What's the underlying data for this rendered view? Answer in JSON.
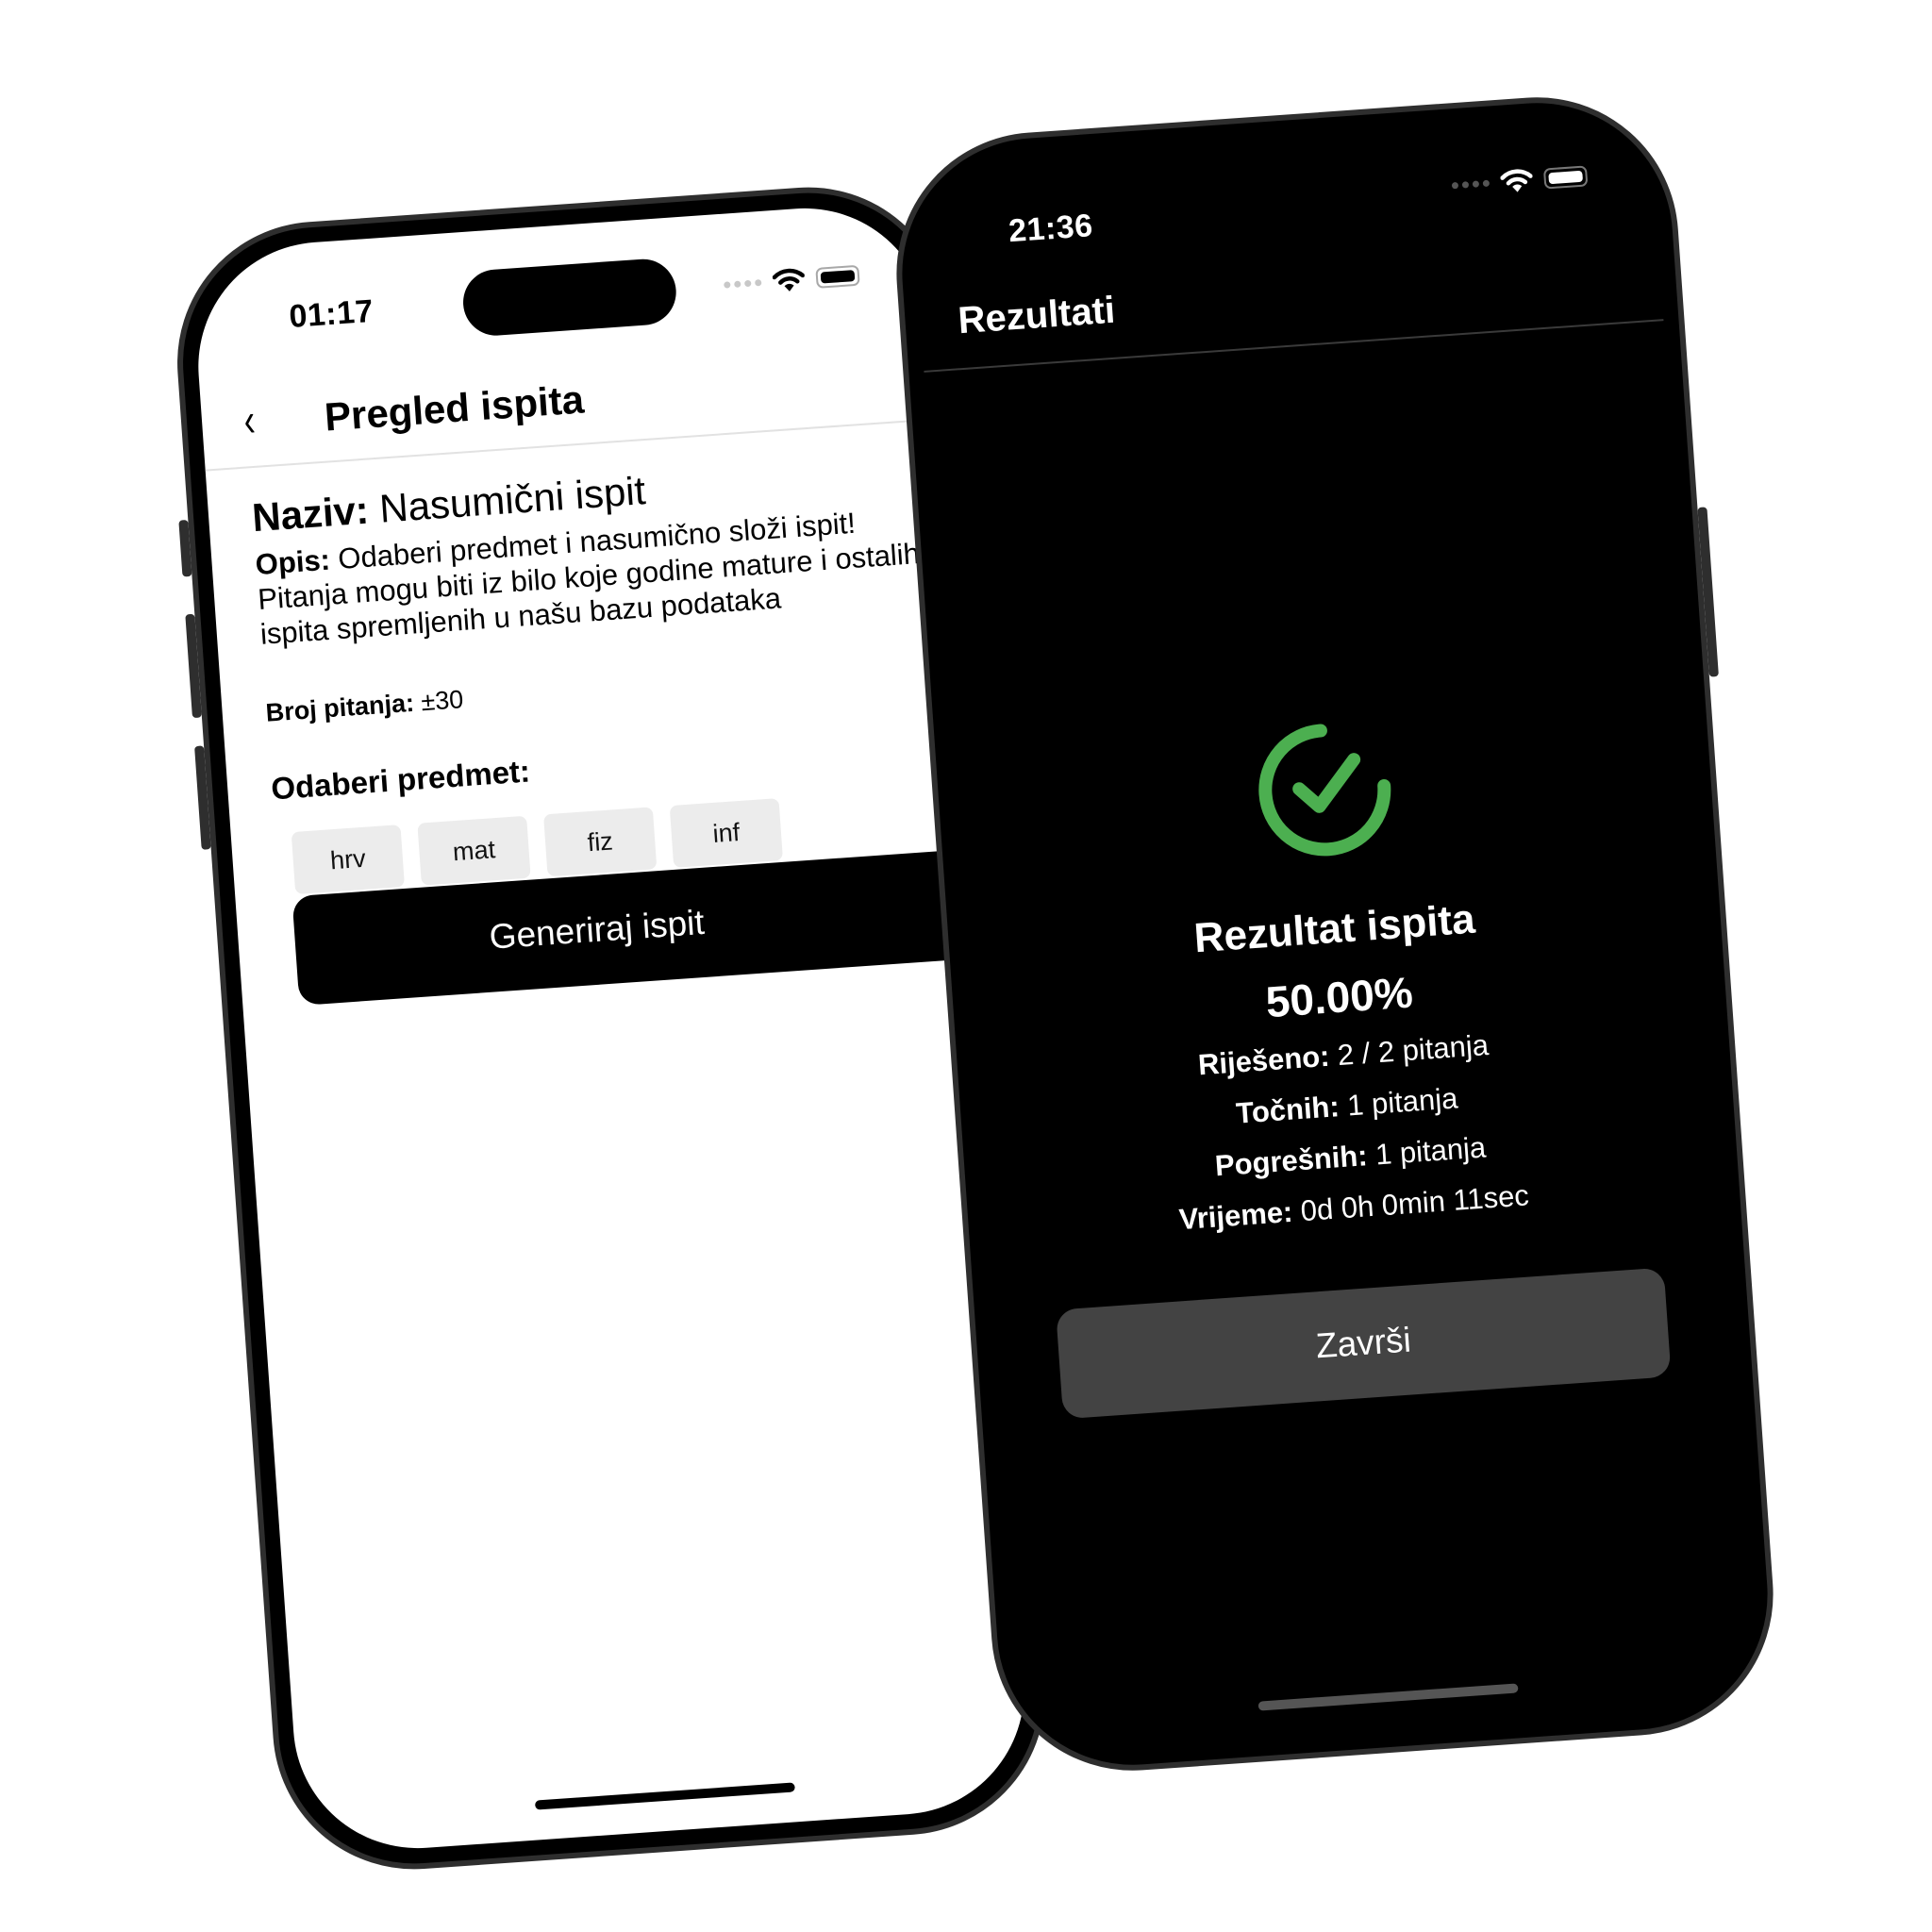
{
  "left_phone": {
    "status_bar": {
      "time": "01:17",
      "icons": [
        "signal-dots-icon",
        "wifi-icon",
        "battery-icon"
      ]
    },
    "nav": {
      "back_icon": "chevron-left-icon",
      "title": "Pregled ispita"
    },
    "exam": {
      "name_label": "Naziv:",
      "name_value": "Nasumični ispit",
      "desc_label": "Opis:",
      "desc_value": "Odaberi predmet i nasumično složi ispit! Pitanja mogu biti iz bilo koje godine mature i ostalih ispita spremljenih u našu bazu podataka",
      "count_label": "Broj pitanja:",
      "count_value": "±30",
      "subject_heading": "Odaberi predmet:",
      "subjects": [
        "hrv",
        "mat",
        "fiz",
        "inf"
      ]
    },
    "generate_button": "Generiraj ispit"
  },
  "right_phone": {
    "status_bar": {
      "time": "21:36",
      "icons": [
        "signal-dots-icon",
        "wifi-icon",
        "battery-icon"
      ]
    },
    "nav": {
      "title": "Rezultati"
    },
    "result": {
      "icon": "check-circle-icon",
      "icon_color": "#4caf50",
      "title": "Rezultat ispita",
      "percentage": "50.00%",
      "stats": [
        {
          "label": "Riješeno:",
          "value": "2 / 2 pitanja"
        },
        {
          "label": "Točnih:",
          "value": "1 pitanja"
        },
        {
          "label": "Pogrešnih:",
          "value": "1 pitanja"
        },
        {
          "label": "Vrijeme:",
          "value": "0d 0h 0min 11sec"
        }
      ]
    },
    "finish_button": "Završi"
  }
}
